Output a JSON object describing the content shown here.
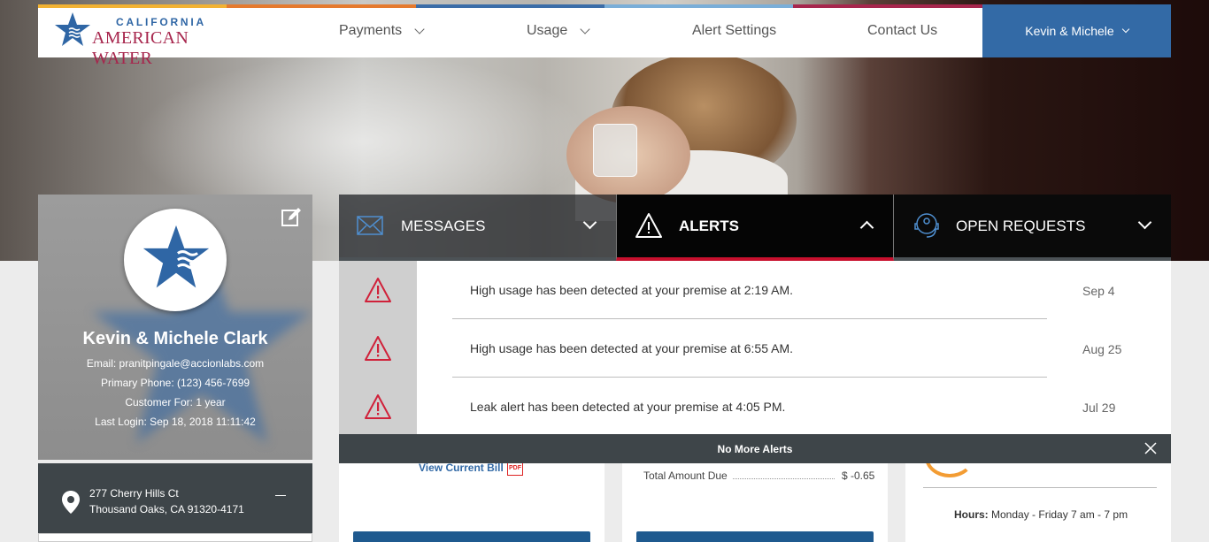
{
  "brand": {
    "line1": "CALIFORNIA",
    "line2": "AMERICAN WATER",
    "colors": {
      "blue": "#2f66a5",
      "crimson": "#a7264d",
      "alert_red": "#c8102e",
      "dark_panel": "#3e4549"
    }
  },
  "nav": {
    "items": [
      {
        "label": "Payments",
        "dropdown": true
      },
      {
        "label": "Usage",
        "dropdown": true
      },
      {
        "label": "Alert Settings",
        "dropdown": false
      },
      {
        "label": "Contact Us",
        "dropdown": false
      }
    ],
    "user_menu": "Kevin & Michele"
  },
  "profile": {
    "name": "Kevin & Michele Clark",
    "email": "Email: pranitpingale@accionlabs.com",
    "phone": "Primary Phone: (123) 456-7699",
    "customer_for": "Customer For: 1 year",
    "last_login": "Last Login: Sep 18, 2018 11:11:42",
    "edit_icon": "edit-icon"
  },
  "address": {
    "line1": "277 Cherry Hills Ct",
    "line2": "Thousand Oaks, CA 91320-4171"
  },
  "tabs": [
    {
      "label": "MESSAGES",
      "icon": "envelope-icon",
      "expanded": false
    },
    {
      "label": "ALERTS",
      "icon": "warning-icon",
      "expanded": true
    },
    {
      "label": "OPEN REQUESTS",
      "icon": "support-agent-icon",
      "expanded": false
    }
  ],
  "alerts": [
    {
      "message": "High usage has been detected at your premise at 2:19 AM.",
      "date": "Sep 4"
    },
    {
      "message": "High usage has been detected at your premise at 6:55 AM.",
      "date": "Aug 25"
    },
    {
      "message": "Leak alert has been detected at your premise at 4:05 PM.",
      "date": "Jul 29"
    }
  ],
  "alerts_footer": "No More Alerts",
  "cards": {
    "bill": {
      "view_current_bill": "View Current Bill",
      "pdf_label": "PDF"
    },
    "due": {
      "label": "Total Amount Due",
      "value": "$ -0.65"
    },
    "support": {
      "hours_label": "Hours:",
      "hours_value": "Monday - Friday 7 am - 7 pm"
    }
  }
}
